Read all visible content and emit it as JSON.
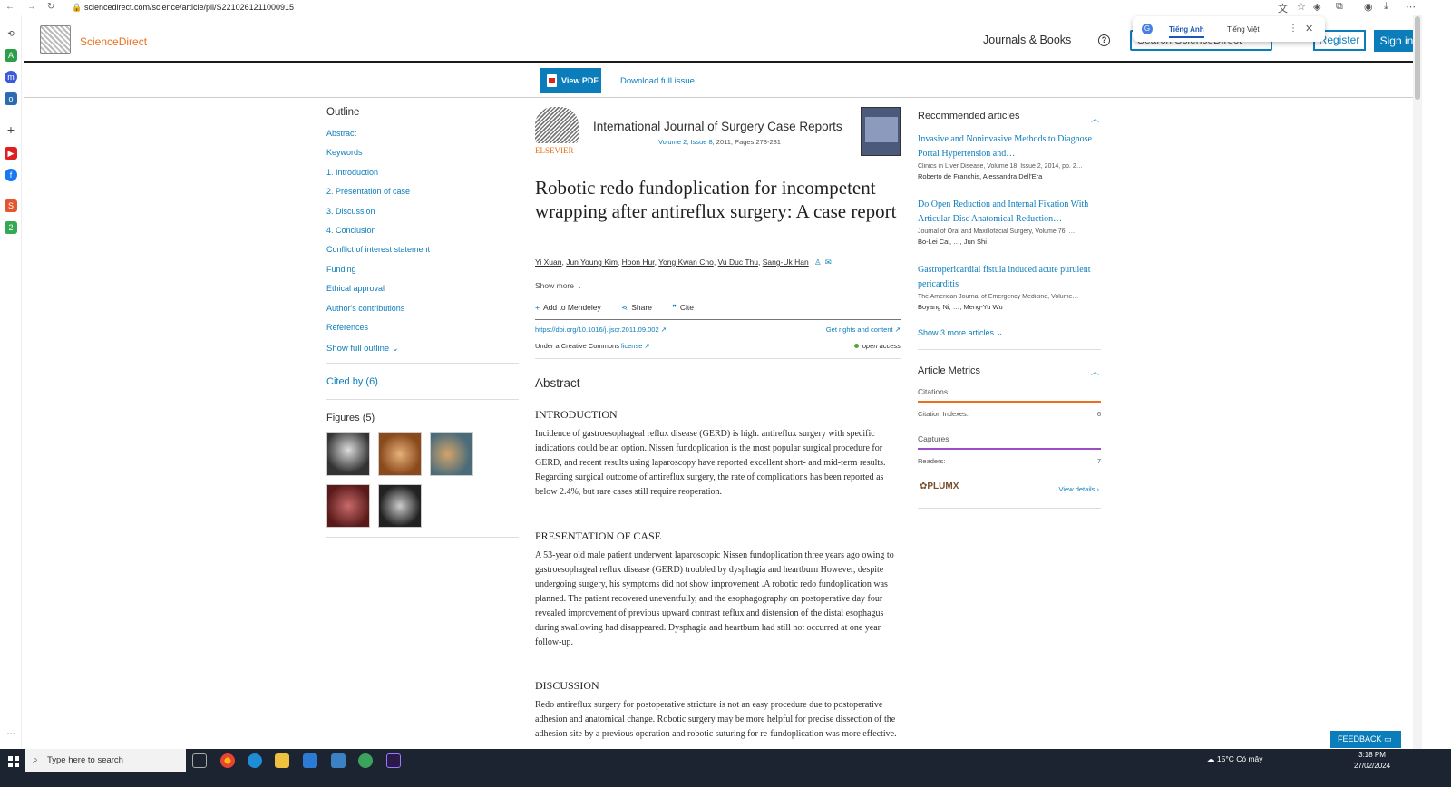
{
  "browser": {
    "url": "sciencedirect.com/science/article/pii/S2210261211000915"
  },
  "translate_popup": {
    "lang_source": "Tiếng Anh",
    "lang_target": "Tiếng Việt"
  },
  "header": {
    "brand": "ScienceDirect",
    "journals_link": "Journals & Books",
    "search_placeholder": "Search ScienceDirect",
    "register_label": "Register",
    "signin_label": "Sign in"
  },
  "pdf_bar": {
    "view_pdf_label": "View PDF",
    "download_issue_label": "Download full issue"
  },
  "outline": {
    "title": "Outline",
    "items": [
      "Abstract",
      "Keywords",
      "1. Introduction",
      "2. Presentation of case",
      "3. Discussion",
      "4. Conclusion",
      "Conflict of interest statement",
      "Funding",
      "Ethical approval",
      "Author's contributions",
      "References"
    ],
    "show_full": "Show full outline",
    "cited_by": "Cited by (6)",
    "figures_title": "Figures (5)"
  },
  "article": {
    "publisher_word": "ELSEVIER",
    "journal_title": "International Journal of Surgery Case Reports",
    "journal_volume": "Volume 2, Issue 8",
    "journal_meta_rest": ", 2011, Pages 278-281",
    "title": "Robotic redo fundoplication for incompetent wrapping after antireflux surgery: A case report",
    "authors": [
      "Yi Xuan",
      "Jun Young Kim",
      "Hoon Hur",
      "Yong Kwan Cho",
      "Vu Duc Thu",
      "Sang-Uk Han"
    ],
    "show_more": "Show more",
    "add_mendeley": "Add to Mendeley",
    "share": "Share",
    "cite": "Cite",
    "doi": "https://doi.org/10.1016/j.ijscr.2011.09.002",
    "rights": "Get rights and content",
    "license_prefix": "Under a Creative Commons",
    "license_link": "license",
    "open_access": "open access",
    "abstract_heading": "Abstract",
    "sections": [
      {
        "heading": "INTRODUCTION",
        "text": "Incidence of gastroesophageal reflux disease (GERD) is high. antireflux surgery with specific indications could be an option. Nissen fundoplication is the most popular surgical procedure for GERD, and recent results using laparoscopy have reported excellent short- and mid-term results. Regarding surgical outcome of antireflux surgery, the rate of complications has been reported as below 2.4%, but rare cases still require reoperation."
      },
      {
        "heading": "PRESENTATION OF CASE",
        "text": "A 53-year old male patient underwent laparoscopic Nissen fundoplication three years ago owing to gastroesophageal reflux disease (GERD) troubled by dysphagia and heartburn However, despite undergoing surgery, his symptoms did not show improvement .A robotic redo fundoplication was planned. The patient recovered uneventfully, and the esophagography on postoperative day four revealed improvement of previous upward contrast reflux and distension of the distal esophagus during swallowing had disappeared. Dysphagia and heartburn had still not occurred at one year follow-up."
      },
      {
        "heading": "DISCUSSION",
        "text": "Redo antireflux surgery for postoperative stricture is not an easy procedure due to postoperative adhesion and anatomical change. Robotic surgery may be more helpful for precise dissection of the adhesion site by a previous operation and robotic suturing for re-fundoplication was more effective."
      }
    ]
  },
  "recommended": {
    "title": "Recommended articles",
    "items": [
      {
        "title": "Invasive and Noninvasive Methods to Diagnose Portal Hypertension and…",
        "source": "Clinics in Liver Disease, Volume 18, Issue 2, 2014, pp. 2…",
        "authors": "Roberto de Franchis, Alessandra Dell'Era"
      },
      {
        "title": "Do Open Reduction and Internal Fixation With Articular Disc Anatomical Reduction…",
        "source": "Journal of Oral and Maxillofacial Surgery, Volume 76, …",
        "authors": "Bo-Lei Cai, …, Jun Shi"
      },
      {
        "title": "Gastropericardial fistula induced acute purulent pericarditis",
        "source": "The American Journal of Emergency Medicine, Volume…",
        "authors": "Boyang Ni, …, Meng-Yu Wu"
      }
    ],
    "show_more": "Show 3 more articles"
  },
  "metrics": {
    "title": "Article Metrics",
    "citations_label": "Citations",
    "citation_indexes_label": "Citation Indexes:",
    "citation_indexes_value": "6",
    "captures_label": "Captures",
    "readers_label": "Readers:",
    "readers_value": "7",
    "plumx": "PLUMX",
    "view_details": "View details"
  },
  "feedback_label": "FEEDBACK",
  "taskbar": {
    "search_placeholder": "Type here to search",
    "weather": "15°C  Có mây",
    "time": "3:18 PM",
    "date": "27/02/2024"
  },
  "colors": {
    "link": "#0c7dbb",
    "brand_orange": "#e9711c",
    "taskbar": "#1c2432"
  }
}
